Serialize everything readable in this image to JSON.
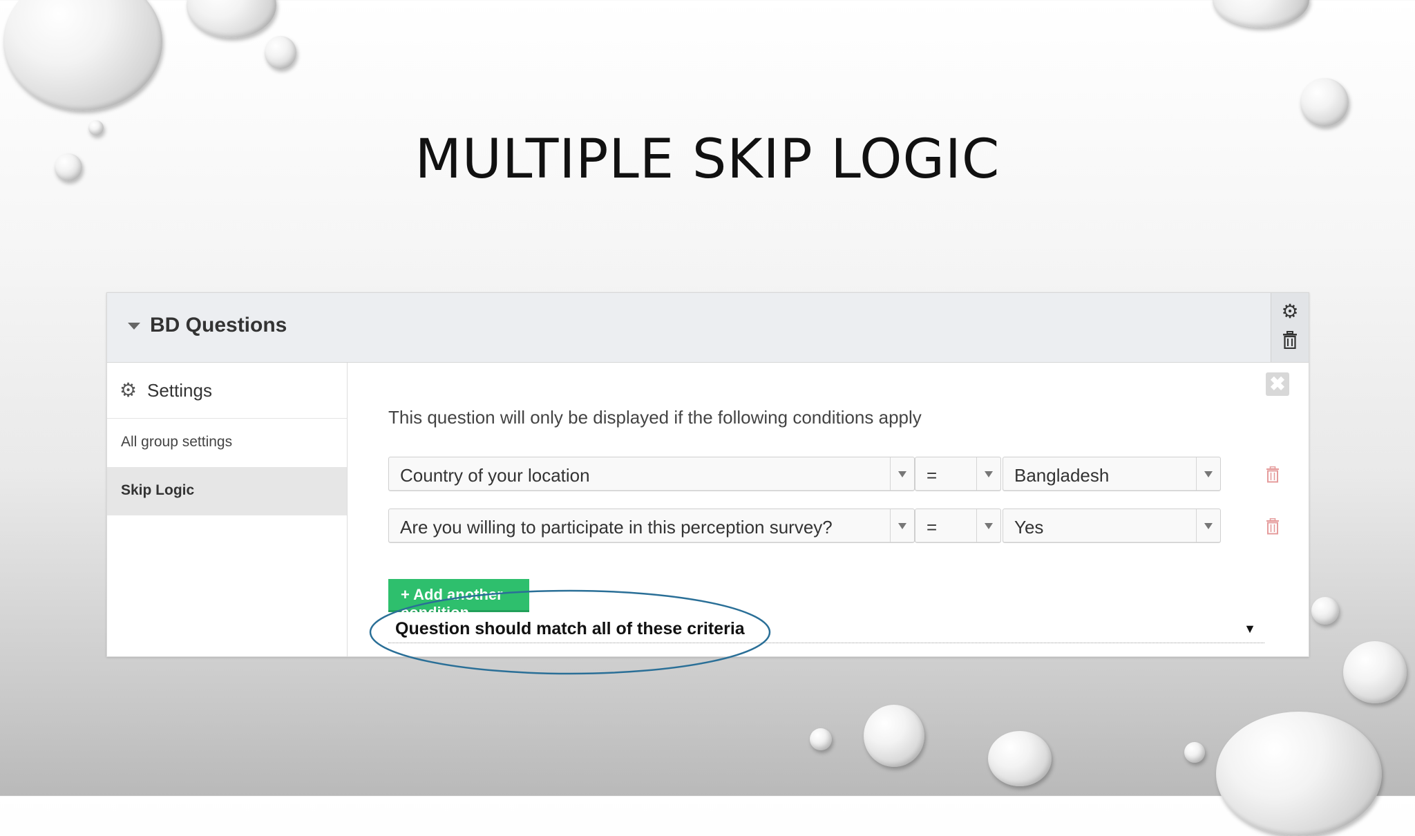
{
  "slide_title": "MULTIPLE SKIP LOGIC",
  "panel": {
    "header_title": "BD Questions",
    "header_icons": [
      "gear-icon",
      "trash-icon"
    ]
  },
  "sidebar": {
    "settings_label": "Settings",
    "items": [
      {
        "label": "All group settings",
        "active": false
      },
      {
        "label": "Skip Logic",
        "active": true
      }
    ]
  },
  "skip_logic": {
    "intro": "This question will only be displayed if the following conditions apply",
    "conditions": [
      {
        "question": "Country of your location",
        "operator": "=",
        "value": "Bangladesh"
      },
      {
        "question": "Are you willing to participate in this perception survey?",
        "operator": "=",
        "value": "Yes"
      }
    ],
    "add_button_label": "+ Add another condition",
    "match_criteria": "Question should match all of these criteria"
  },
  "colors": {
    "add_button": "#2ebf6d",
    "highlight_oval": "#2a6f97",
    "delete_icon": "#e59b9b"
  }
}
